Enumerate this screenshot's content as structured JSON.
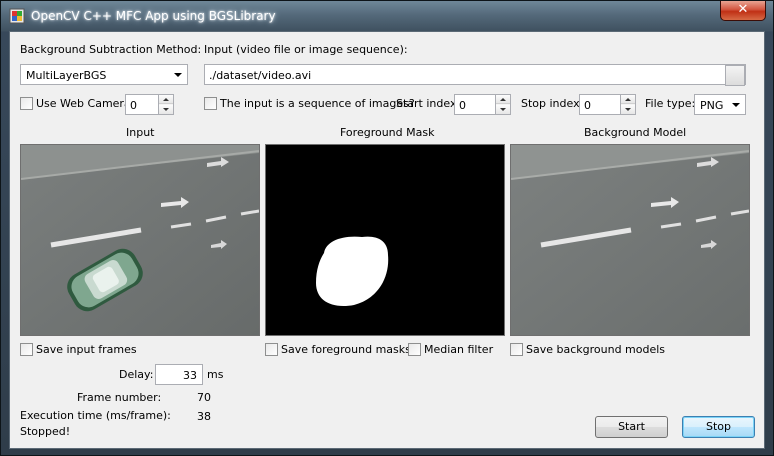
{
  "window": {
    "title": "OpenCV C++ MFC App using BGSLibrary",
    "close_glyph": "✕"
  },
  "method": {
    "label": "Background Subtraction Method:",
    "value": "MultiLayerBGS"
  },
  "input": {
    "label": "Input (video file or image sequence):",
    "value": "./dataset/video.avi"
  },
  "webcam": {
    "label": "Use Web Camera",
    "index": "0",
    "checked": false
  },
  "sequence": {
    "label": "The input is a sequence of images?",
    "checked": false,
    "start_label": "Start index:",
    "start_value": "0",
    "stop_label": "Stop index:",
    "stop_value": "0",
    "filetype_label": "File type:",
    "filetype_value": "PNG"
  },
  "panels": {
    "input_title": "Input",
    "fg_title": "Foreground Mask",
    "bg_title": "Background Model"
  },
  "options": {
    "save_input": "Save input frames",
    "save_fg": "Save foreground masks",
    "median": "Median filter",
    "save_bg": "Save background models"
  },
  "stats": {
    "delay_label": "Delay:",
    "delay_value": "33",
    "delay_unit": "ms",
    "frame_label": "Frame number:",
    "frame_value": "70",
    "exec_label": "Execution time (ms/frame):",
    "exec_value": "38",
    "status": "Stopped!"
  },
  "buttons": {
    "start": "Start",
    "stop": "Stop"
  }
}
